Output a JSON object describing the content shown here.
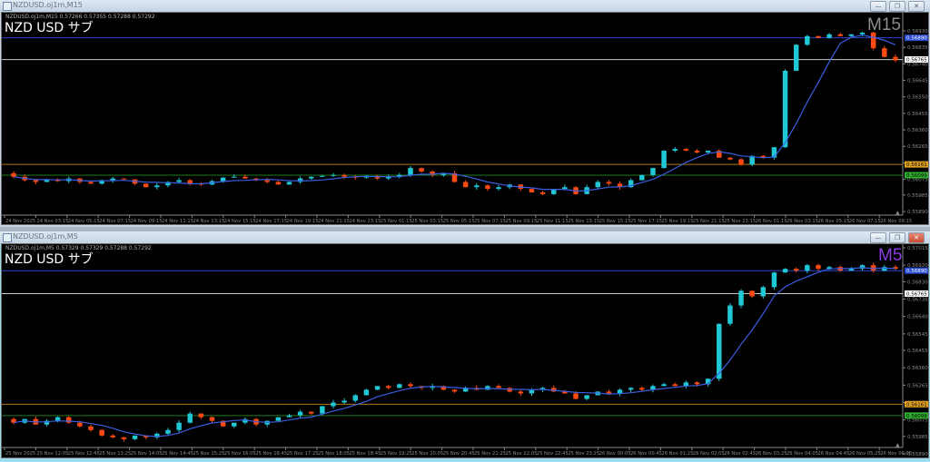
{
  "windows": [
    {
      "title": "NZDUSD.oj1m,M15",
      "ohlc": "NZDUSD.oj1m,M15  0.57266 0.57355 0.57288 0.57292",
      "subtitle": "NZD USD サブ",
      "timeframe": "M15",
      "timeframe_color": "#8c8c8c",
      "controls": {
        "minimize": "—",
        "restore": "❐",
        "close": "✕"
      }
    },
    {
      "title": "NZDUSD.oj1m,M5",
      "ohlc": "NZDUSD.oj1m,M5  0.57329 0.57329 0.57288 0.57292",
      "subtitle": "NZD USD サブ",
      "timeframe": "M5",
      "timeframe_color": "#8a3ce0",
      "controls": {
        "minimize": "—",
        "restore": "❐",
        "close": "✕"
      }
    }
  ],
  "colors": {
    "bull": "#1fc8d4",
    "bear": "#ff4a12",
    "ma": "#3a5ee0",
    "axis": "#8c8c8c"
  },
  "chart_data": [
    {
      "type": "candlestick",
      "title": "NZDUSD.oj1m,M15",
      "ylim": [
        0.5589,
        0.5693
      ],
      "yticks": [
        "0.56930",
        "0.56835",
        "0.56740",
        "0.56645",
        "0.56550",
        "0.56455",
        "0.56360",
        "0.56265",
        "0.56170",
        "0.56075",
        "0.55985",
        "0.55890"
      ],
      "xticks": [
        "24 Nov 2025",
        "24 Nov 03:15",
        "24 Nov 05:15",
        "24 Nov 07:15",
        "24 Nov 09:15",
        "24 Nov 11:15",
        "24 Nov 13:15",
        "24 Nov 15:15",
        "24 Nov 17:15",
        "24 Nov 19:15",
        "24 Nov 21:15",
        "24 Nov 23:15",
        "25 Nov 01:15",
        "25 Nov 03:15",
        "25 Nov 05:15",
        "25 Nov 07:15",
        "25 Nov 09:15",
        "25 Nov 11:15",
        "25 Nov 13:15",
        "25 Nov 15:15",
        "25 Nov 17:15",
        "25 Nov 19:15",
        "25 Nov 21:15",
        "25 Nov 23:15",
        "26 Nov 01:15",
        "26 Nov 03:15",
        "26 Nov 05:15",
        "26 Nov 07:15",
        "26 Nov 09:15"
      ],
      "hlines": [
        {
          "value": "0.56890",
          "color": "#2846c8",
          "label_bg": "#2a4cd0",
          "label_fg": "#ffffff"
        },
        {
          "value": "0.56765",
          "color": "#c8c8c8",
          "label_bg": "#ffffff",
          "label_fg": "#000000"
        },
        {
          "value": "0.56161",
          "color": "#b07a10",
          "label_bg": "#e0a020",
          "label_fg": "#000000"
        },
        {
          "value": "0.56099",
          "color": "#1e7a1e",
          "label_bg": "#30b030",
          "label_fg": "#000000"
        }
      ],
      "closes": [
        0.5609,
        0.5607,
        0.5606,
        0.56075,
        0.56065,
        0.5608,
        0.5606,
        0.5605,
        0.5607,
        0.5608,
        0.56075,
        0.5605,
        0.5603,
        0.5604,
        0.5606,
        0.5607,
        0.5605,
        0.56045,
        0.56065,
        0.56085,
        0.5609,
        0.5608,
        0.5607,
        0.5606,
        0.56045,
        0.5606,
        0.5608,
        0.5609,
        0.56095,
        0.561,
        0.5609,
        0.56085,
        0.56095,
        0.5608,
        0.5609,
        0.561,
        0.5614,
        0.5612,
        0.561,
        0.5611,
        0.5606,
        0.5603,
        0.5604,
        0.5602,
        0.5603,
        0.56045,
        0.5602,
        0.56,
        0.5599,
        0.5602,
        0.5603,
        0.5599,
        0.5603,
        0.5606,
        0.5605,
        0.5603,
        0.5607,
        0.561,
        0.5614,
        0.5624,
        0.5625,
        0.5624,
        0.5623,
        0.5624,
        0.562,
        0.5619,
        0.5616,
        0.5621,
        0.562,
        0.5626,
        0.567,
        0.5685,
        0.569,
        0.5689,
        0.5691,
        0.569,
        0.5691,
        0.5692,
        0.5683,
        0.5678,
        0.5676
      ]
    },
    {
      "type": "candlestick",
      "title": "NZDUSD.oj1m,M5",
      "ylim": [
        0.5589,
        0.57015
      ],
      "yticks": [
        "0.57015",
        "0.56920",
        "0.56830",
        "0.56735",
        "0.56640",
        "0.56545",
        "0.56455",
        "0.56360",
        "0.56265",
        "0.56170",
        "0.56075",
        "0.55985",
        "0.55890"
      ],
      "xticks": [
        "25 Nov 2025",
        "25 Nov 12:05",
        "25 Nov 12:45",
        "25 Nov 13:25",
        "25 Nov 14:05",
        "25 Nov 14:45",
        "25 Nov 15:25",
        "25 Nov 16:05",
        "25 Nov 16:45",
        "25 Nov 17:25",
        "25 Nov 18:05",
        "25 Nov 18:45",
        "25 Nov 19:25",
        "25 Nov 20:05",
        "25 Nov 20:45",
        "25 Nov 21:25",
        "25 Nov 22:05",
        "25 Nov 22:45",
        "25 Nov 23:25",
        "26 Nov 00:05",
        "26 Nov 00:45",
        "26 Nov 01:25",
        "26 Nov 02:05",
        "26 Nov 02:45",
        "26 Nov 03:25",
        "26 Nov 04:05",
        "26 Nov 04:45",
        "26 Nov 05:25",
        "26 Nov 06:05"
      ],
      "hlines": [
        {
          "value": "0.56890",
          "color": "#2846c8",
          "label_bg": "#2a4cd0",
          "label_fg": "#ffffff"
        },
        {
          "value": "0.56765",
          "color": "#c8c8c8",
          "label_bg": "#ffffff",
          "label_fg": "#000000"
        },
        {
          "value": "0.56161",
          "color": "#b07a10",
          "label_bg": "#e0a020",
          "label_fg": "#000000"
        },
        {
          "value": "0.56099",
          "color": "#1e7a1e",
          "label_bg": "#30b030",
          "label_fg": "#000000"
        }
      ],
      "closes": [
        0.5606,
        0.5608,
        0.5605,
        0.5607,
        0.5609,
        0.5606,
        0.5604,
        0.5602,
        0.5599,
        0.5598,
        0.5597,
        0.5599,
        0.5598,
        0.56,
        0.5602,
        0.5606,
        0.5611,
        0.5609,
        0.5607,
        0.5604,
        0.5606,
        0.5608,
        0.5605,
        0.5607,
        0.5609,
        0.561,
        0.5612,
        0.5611,
        0.5615,
        0.5617,
        0.5618,
        0.5621,
        0.5624,
        0.5626,
        0.5625,
        0.5627,
        0.5626,
        0.5625,
        0.5626,
        0.5624,
        0.5623,
        0.5625,
        0.5624,
        0.5626,
        0.5625,
        0.5623,
        0.5622,
        0.5624,
        0.5625,
        0.5623,
        0.5622,
        0.5619,
        0.5621,
        0.5623,
        0.5622,
        0.5624,
        0.5625,
        0.5624,
        0.5626,
        0.5627,
        0.5626,
        0.5628,
        0.5627,
        0.563,
        0.566,
        0.567,
        0.5678,
        0.5675,
        0.568,
        0.5688,
        0.569,
        0.5689,
        0.5692,
        0.569,
        0.5691,
        0.5689,
        0.569,
        0.5692,
        0.5689,
        0.5691,
        0.569
      ]
    }
  ]
}
